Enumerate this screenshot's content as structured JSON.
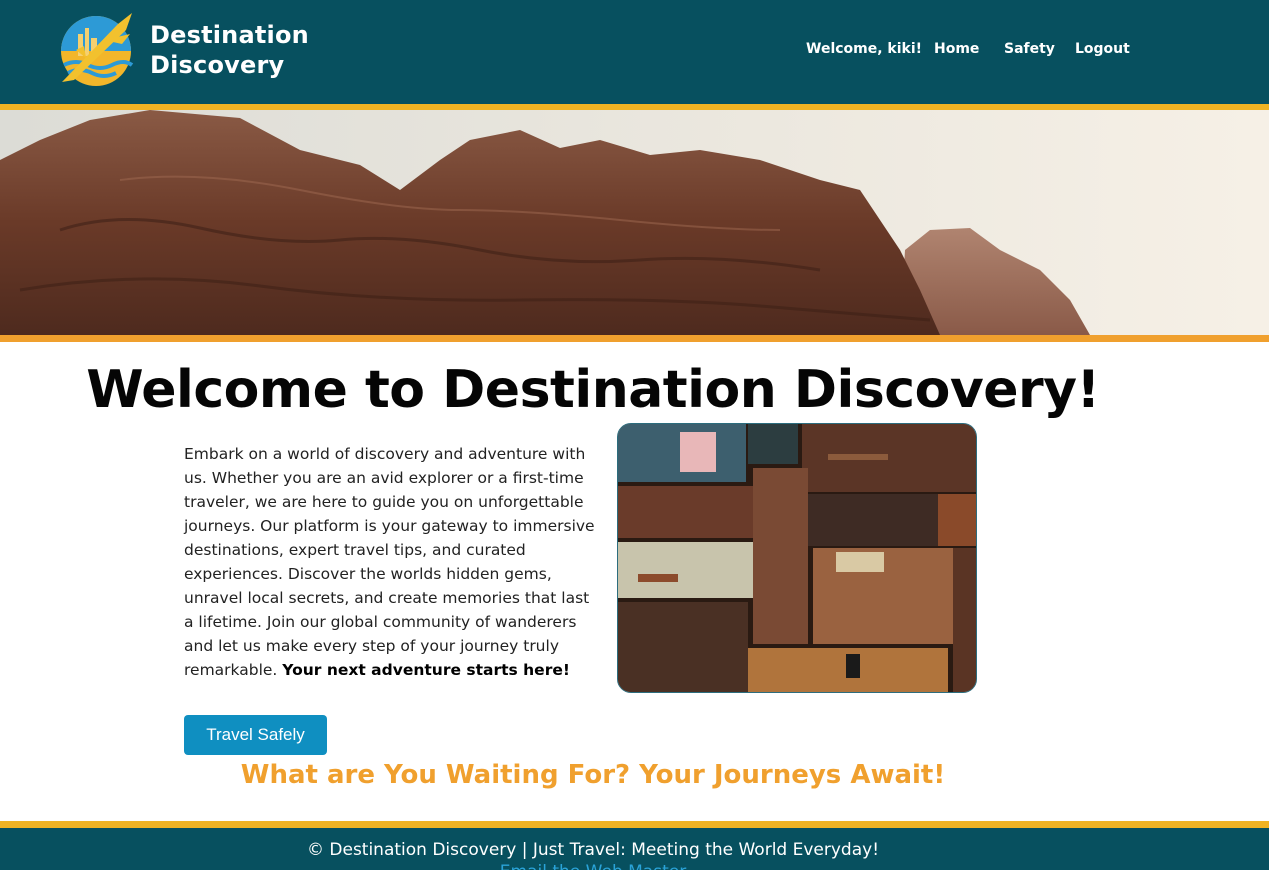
{
  "header": {
    "brand_line1": "Destination",
    "brand_line2": "Discovery",
    "logo_icon": "airplane-globe-logo",
    "colors": {
      "background": "#07505f",
      "stripe": "#f0b323"
    }
  },
  "nav": {
    "welcome": "Welcome, kiki!",
    "home": "Home",
    "safety": "Safety",
    "logout": "Logout"
  },
  "hero": {
    "image": "red-rock-cliffs-photo"
  },
  "main": {
    "title": "Welcome to Destination Discovery!",
    "intro_text": "Embark on a world of discovery and adventure with us. Whether you are an avid explorer or a first-time traveler, we are here to guide you on unforgettable journeys. Our platform is your gateway to immersive destinations, expert travel tips, and curated experiences. Discover the worlds hidden gems, unravel local secrets, and create memories that last a lifetime. Join our global community of wanderers and let us make every step of your journey truly remarkable.",
    "intro_bold": "Your next adventure starts here!",
    "cta_label": "Travel Safely",
    "photo": "vintage-suitcases-photo",
    "tagline": "What are You Waiting For? Your Journeys Await!",
    "colors": {
      "accent": "#f0a02e",
      "button": "#0f8fc1"
    }
  },
  "footer": {
    "text": "© Destination Discovery | Just Travel: Meeting the World Everyday!",
    "link": "Email the Web Master"
  }
}
